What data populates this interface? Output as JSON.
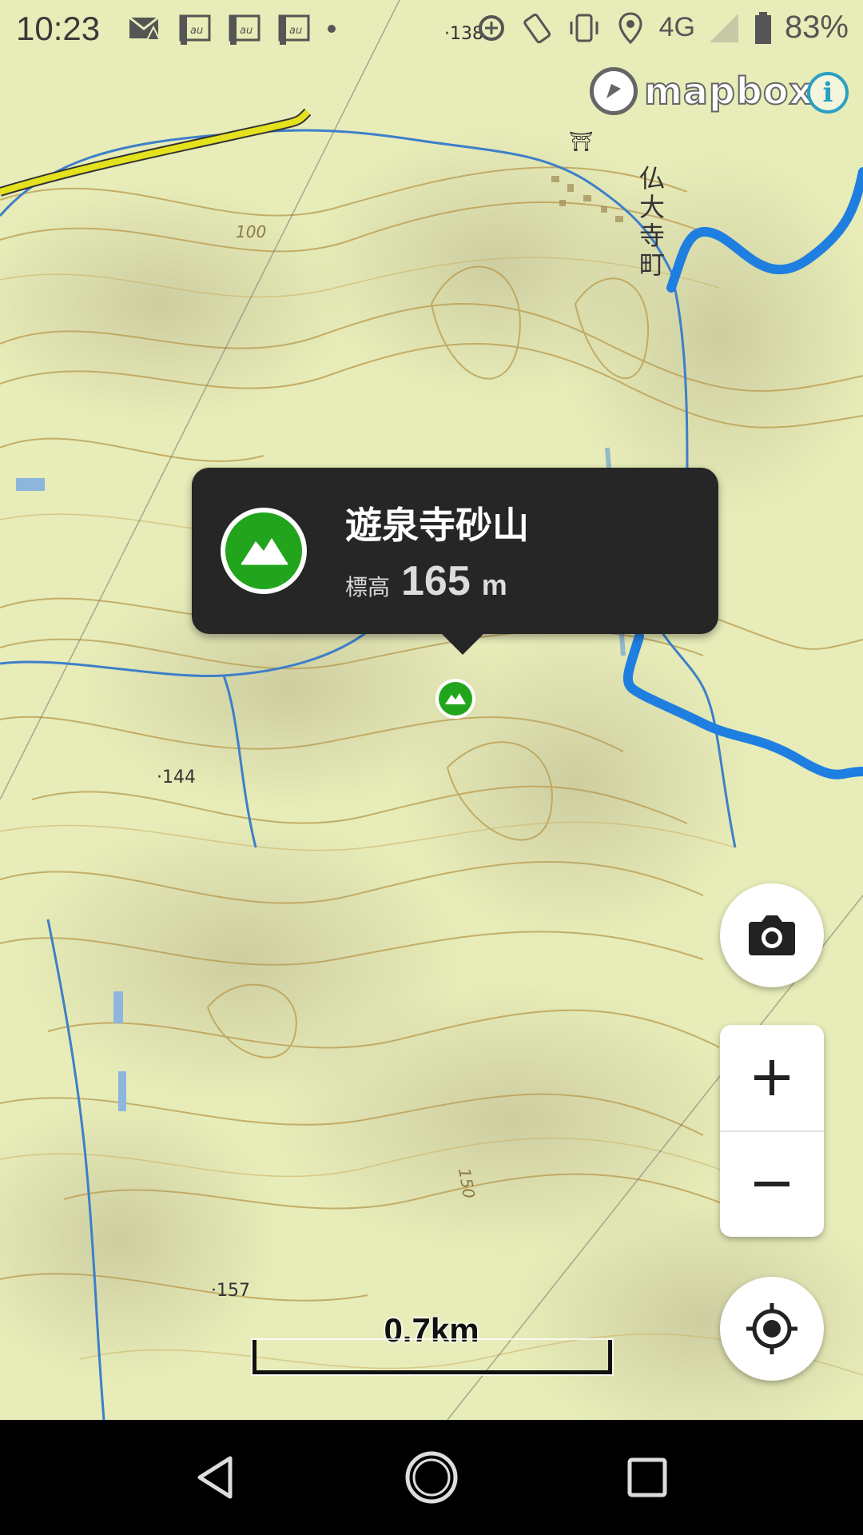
{
  "status_bar": {
    "time": "10:23",
    "network": "4G",
    "battery": "83%",
    "left_icons": [
      "mail-error-icon",
      "au-notification-icon",
      "au-notification-icon",
      "au-notification-icon",
      "dot-icon"
    ],
    "right_icons": [
      "data-saver-icon",
      "rotate-icon",
      "vibrate-icon",
      "location-icon",
      "signal-icon",
      "battery-icon"
    ]
  },
  "map": {
    "attribution": "mapbox",
    "info_icon": "i",
    "labels": {
      "town": [
        "仏",
        "大",
        "寺",
        "町"
      ],
      "contour_100": "100",
      "contour_150": "150",
      "spot_138": "138",
      "spot_144": "144",
      "spot_157": "157"
    },
    "colors": {
      "terrain": "#e6ebb6",
      "contour": "#b89a4e",
      "river": "#3d7fc9",
      "route": "#1f7fe0",
      "road": "#e3e21d",
      "peak": "#22a51d"
    }
  },
  "popup": {
    "name": "遊泉寺砂山",
    "elevation_label": "標高",
    "elevation_value": "165",
    "elevation_unit": "m",
    "icon": "mountain-icon"
  },
  "marker": {
    "icon": "mountain-icon"
  },
  "controls": {
    "camera": "camera-icon",
    "zoom_in": "+",
    "zoom_out": "−",
    "locate": "crosshair-icon"
  },
  "scale_bar": {
    "label": "0.7km"
  },
  "nav_bar": {
    "back": "back-icon",
    "home": "home-icon",
    "recents": "recents-icon"
  }
}
